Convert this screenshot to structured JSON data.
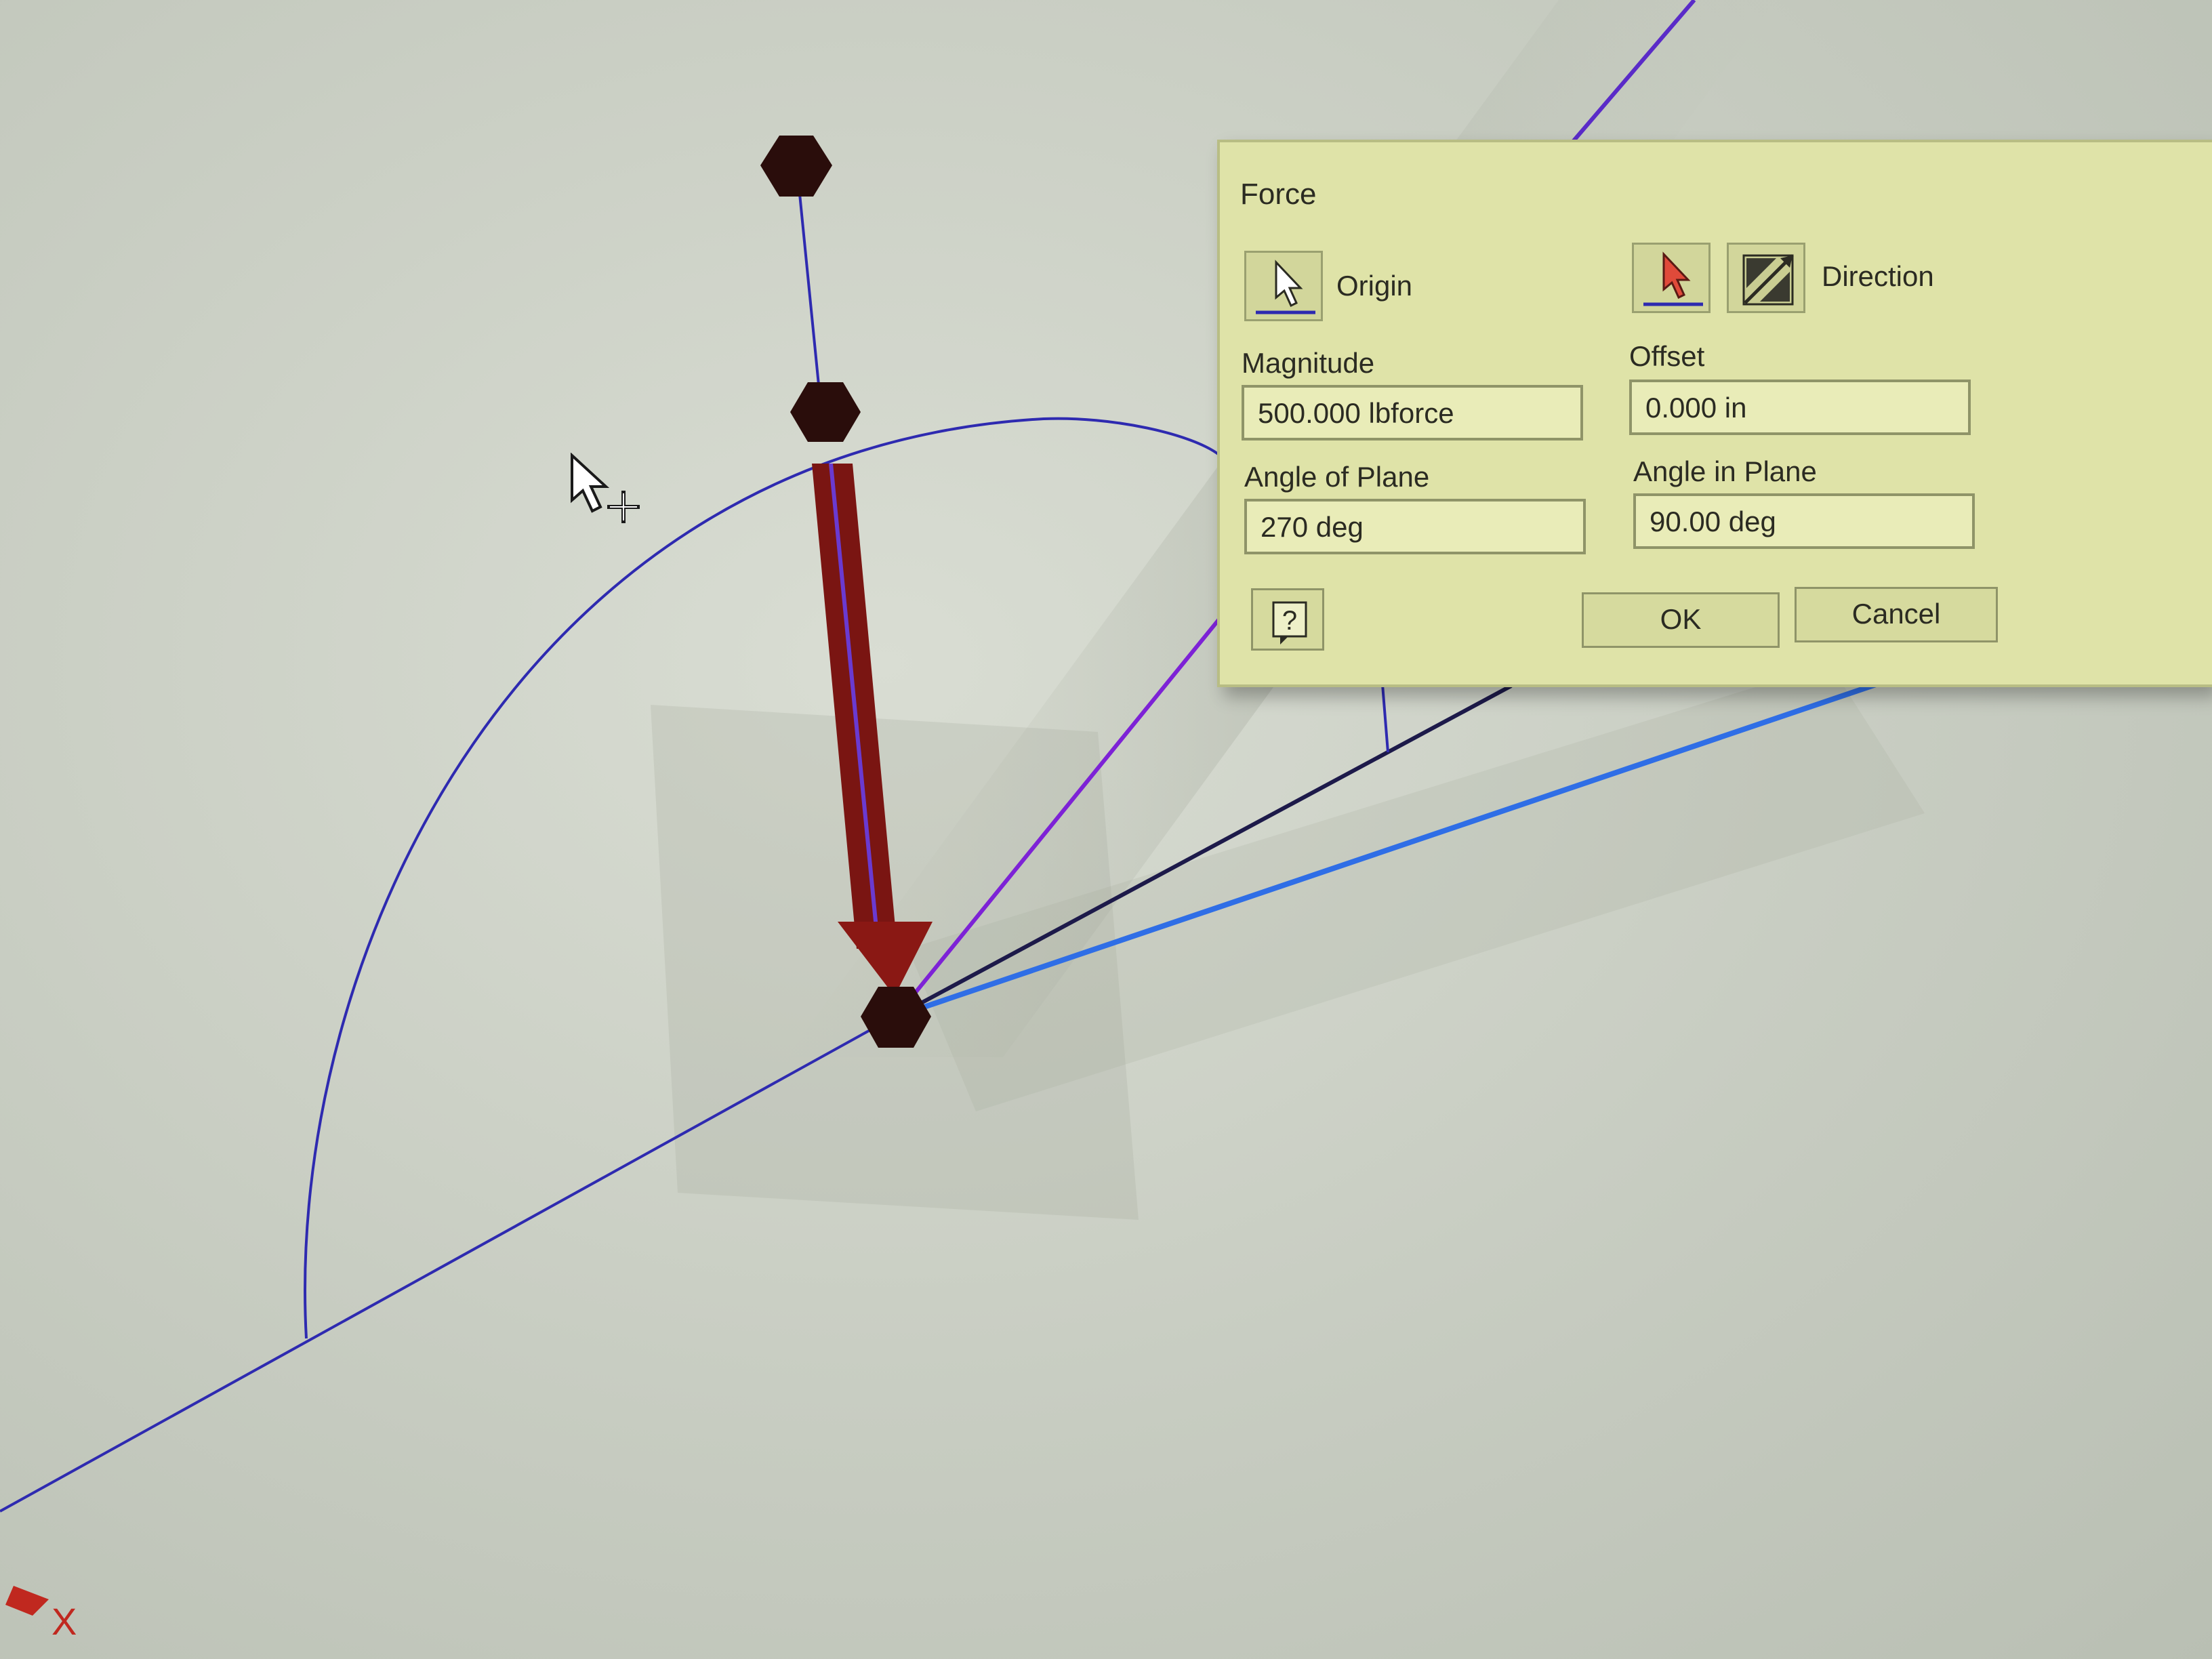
{
  "dialog": {
    "title": "Force",
    "origin_label": "Origin",
    "direction_label": "Direction",
    "magnitude": {
      "label": "Magnitude",
      "value": "500.000 lbforce"
    },
    "offset": {
      "label": "Offset",
      "value": "0.000 in"
    },
    "angle_of_plane": {
      "label": "Angle of Plane",
      "value": "270 deg"
    },
    "angle_in_plane": {
      "label": "Angle in Plane",
      "value": "90.00 deg"
    },
    "ok_label": "OK",
    "cancel_label": "Cancel",
    "help_glyph": "?"
  },
  "viewport": {
    "axis_label": "X",
    "force_color": "#7a1512",
    "node_color": "#2a0d0b"
  },
  "icons": {
    "origin_select": "cursor-select-icon",
    "direction_select": "cursor-select-red-icon",
    "flip_direction": "flip-direction-icon",
    "help": "help-icon",
    "cursor": "move-cursor-icon"
  }
}
